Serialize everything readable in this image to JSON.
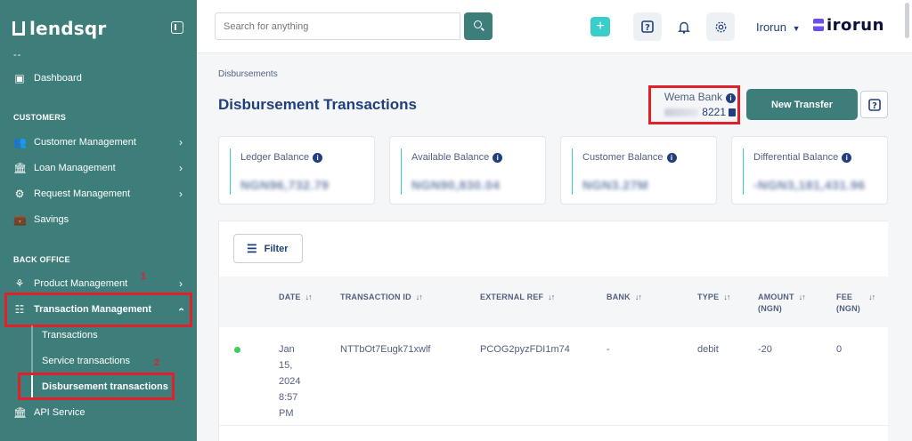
{
  "sidebar": {
    "logo_text": "lendsqr",
    "switch_text": "--",
    "dashboard": "Dashboard",
    "section_customers": "CUSTOMERS",
    "customer_management": "Customer Management",
    "loan_management": "Loan Management",
    "request_management": "Request Management",
    "savings": "Savings",
    "section_back_office": "BACK OFFICE",
    "product_management": "Product Management",
    "transaction_management": "Transaction Management",
    "sub_transactions": "Transactions",
    "sub_service_transactions": "Service transactions",
    "sub_disbursement_transactions": "Disbursement transactions",
    "api_service": "API Service",
    "annotation_1": "1",
    "annotation_2": "2"
  },
  "topbar": {
    "search_placeholder": "Search for anything",
    "user_name": "Irorun",
    "brand_name": "irorun"
  },
  "main": {
    "breadcrumb": "Disbursements",
    "title": "Disbursement Transactions",
    "bank_name": "Wema Bank",
    "account_suffix": "8221",
    "new_transfer_label": "New Transfer",
    "cards": [
      {
        "label": "Ledger Balance",
        "value": "NGN96,732.79"
      },
      {
        "label": "Available Balance",
        "value": "NGN90,830.04"
      },
      {
        "label": "Customer Balance",
        "value": "NGN3.27M"
      },
      {
        "label": "Differential Balance",
        "value": "-NGN3,181,431.96"
      }
    ],
    "filter_label": "Filter",
    "table": {
      "headers": {
        "date": "DATE",
        "transaction_id": "TRANSACTION ID",
        "external_ref": "EXTERNAL REF",
        "bank": "BANK",
        "type": "TYPE",
        "amount_line1": "AMOUNT",
        "amount_line2": "(NGN)",
        "fee_line1": "FEE",
        "fee_line2": "(NGN)"
      },
      "rows": [
        {
          "date_line1": "Jan",
          "date_line2": "15,",
          "date_line3": "2024",
          "date_line4": "8:57",
          "date_line5": "PM",
          "transaction_id": "NTTbOt7Eugk71xwlf",
          "external_ref": "PCOG2pyzFDI1m74",
          "bank": "-",
          "type": "debit",
          "amount": "-20",
          "fee": "0"
        }
      ]
    }
  },
  "colors": {
    "sidebar_bg": "#3d7d7a",
    "accent_teal": "#39cdcc",
    "text_navy": "#213f7d",
    "annotation_red": "#e0202a",
    "status_green": "#39cd62"
  }
}
